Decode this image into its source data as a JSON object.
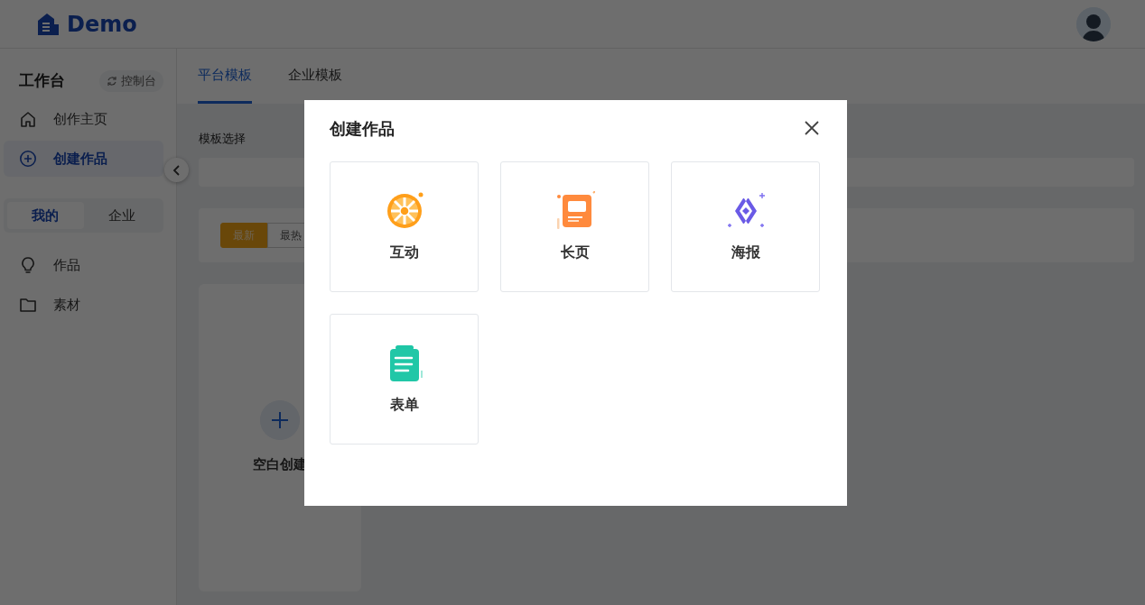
{
  "header": {
    "logo_text": "Demo"
  },
  "sidebar": {
    "title": "工作台",
    "console_button": "控制台",
    "nav": [
      {
        "label": "创作主页",
        "kind": "home",
        "selected": false
      },
      {
        "label": "创建作品",
        "kind": "plus",
        "selected": true
      }
    ],
    "scope_tabs": [
      {
        "label": "我的",
        "selected": true
      },
      {
        "label": "企业",
        "selected": false
      }
    ],
    "library": [
      {
        "label": "作品",
        "kind": "bulb",
        "selected": false
      },
      {
        "label": "素材",
        "kind": "folder",
        "selected": false
      }
    ]
  },
  "main": {
    "tabs": [
      {
        "label": "平台模板",
        "selected": true
      },
      {
        "label": "企业模板",
        "selected": false
      }
    ],
    "section_label": "模板选择",
    "sort_tabs": [
      {
        "label": "最新",
        "selected": true
      },
      {
        "label": "最热",
        "selected": false
      }
    ],
    "blank_card": {
      "label": "空白创建"
    }
  },
  "modal": {
    "title": "创建作品",
    "options": [
      {
        "label": "互动",
        "kind": "wheel"
      },
      {
        "label": "长页",
        "kind": "page"
      },
      {
        "label": "海报",
        "kind": "poster"
      },
      {
        "label": "表单",
        "kind": "form"
      }
    ]
  }
}
